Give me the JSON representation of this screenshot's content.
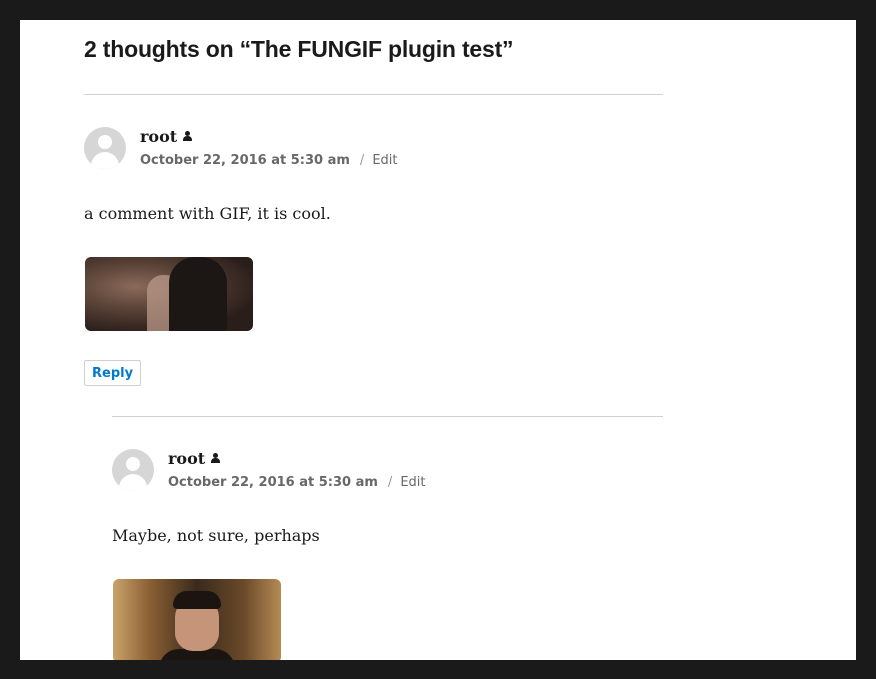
{
  "comments_title": "2 thoughts on “The FUNGIF plugin test”",
  "comments": [
    {
      "author": "root",
      "date": "October 22, 2016 at 5:30 am",
      "separator": "/",
      "edit_label": "Edit",
      "text": "a comment with GIF, it is cool.",
      "reply_label": "Reply"
    },
    {
      "author": "root",
      "date": "October 22, 2016 at 5:30 am",
      "separator": "/",
      "edit_label": "Edit",
      "text": "Maybe, not sure, perhaps"
    }
  ],
  "colors": {
    "accent": "#007acc",
    "text": "#1a1a1a",
    "meta": "#686868",
    "border": "#d1d1d1",
    "frame": "#1a1a1a"
  },
  "icons": {
    "avatar": "default-avatar-icon",
    "author_badge": "post-author-icon"
  }
}
